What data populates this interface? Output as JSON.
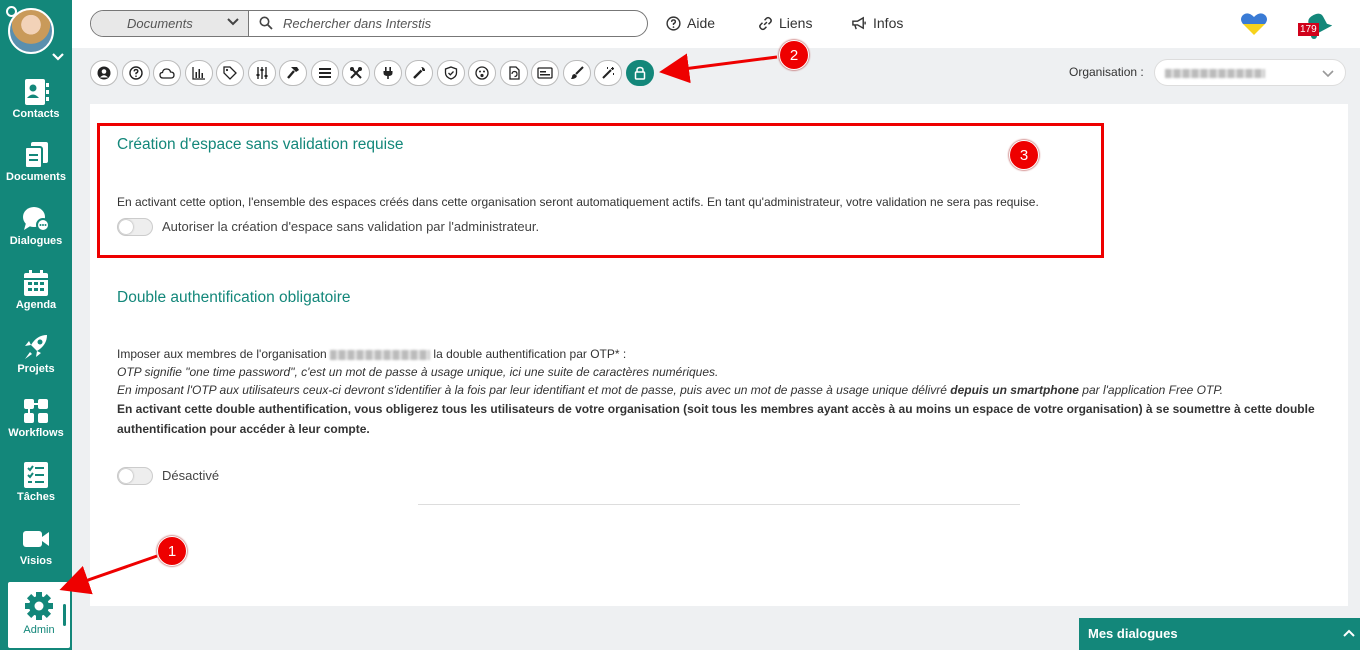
{
  "sidebar": {
    "items": [
      {
        "label": "Contacts",
        "icon": "contacts-icon"
      },
      {
        "label": "Documents",
        "icon": "documents-icon"
      },
      {
        "label": "Dialogues",
        "icon": "dialogues-icon"
      },
      {
        "label": "Agenda",
        "icon": "calendar-icon"
      },
      {
        "label": "Projets",
        "icon": "rocket-icon"
      },
      {
        "label": "Workflows",
        "icon": "workflow-icon"
      },
      {
        "label": "Tâches",
        "icon": "tasks-icon"
      },
      {
        "label": "Visios",
        "icon": "video-icon"
      },
      {
        "label": "Admin",
        "icon": "gear-icon"
      }
    ],
    "active_item": "Admin"
  },
  "topbar": {
    "doc_select": "Documents",
    "search_placeholder": "Rechercher dans Interstis",
    "links": [
      {
        "label": "Aide",
        "icon": "help-icon"
      },
      {
        "label": "Liens",
        "icon": "link-icon"
      },
      {
        "label": "Infos",
        "icon": "megaphone-icon"
      }
    ],
    "notification_count": "179"
  },
  "toolbar": {
    "buttons": [
      "user-icon",
      "help-circle-icon",
      "cloud-icon",
      "chart-icon",
      "tag-icon",
      "sliders-icon",
      "hammer-icon",
      "list-icon",
      "tools-icon",
      "plug-icon",
      "wrench-icon",
      "shield-icon",
      "face-icon",
      "file-refresh-icon",
      "card-icon",
      "brush-icon",
      "magic-wand-icon",
      "lock-icon"
    ],
    "active_button": "lock-icon",
    "org_label": "Organisation :"
  },
  "section1": {
    "title": "Création d'espace sans validation requise",
    "description": "En activant cette option, l'ensemble des espaces créés dans cette organisation seront automatiquement actifs. En tant qu'administrateur, votre validation ne sera pas requise.",
    "toggle_label": "Autoriser la création d'espace sans validation par l'administrateur."
  },
  "section2": {
    "title": "Double authentification obligatoire",
    "line1_prefix": "Imposer aux membres de l'organisation",
    "line1_suffix": "la double authentification par OTP* :",
    "line2": "OTP signifie \"one time password\", c'est un mot de passe à usage unique, ici une suite de caractères numériques.",
    "line3_prefix": "En imposant l'OTP aux utilisateurs ceux-ci devront s'identifier à la fois par leur identifiant et mot de passe, puis avec un mot de passe à usage unique délivré",
    "line3_bold": "depuis un smartphone",
    "line3_suffix": "par l'application Free OTP.",
    "line4": "En activant cette double authentification, vous obligerez tous les utilisateurs de votre organisation (soit tous les membres ayant accès à au moins un espace de votre organisation) à se soumettre à cette double authentification pour accéder à leur compte.",
    "toggle_label": "Désactivé"
  },
  "annotations": {
    "m1": "1",
    "m2": "2",
    "m3": "3"
  },
  "dialogs_panel": {
    "label": "Mes dialogues"
  },
  "colors": {
    "primary": "#13877a",
    "annotation": "#e00000"
  }
}
